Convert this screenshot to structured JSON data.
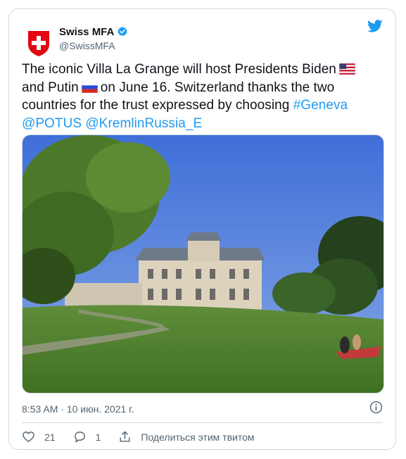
{
  "author": {
    "name": "Swiss MFA",
    "handle": "@SwissMFA",
    "avatar_icon": "swiss-cross-shield-icon",
    "verified_icon": "verified-badge-icon"
  },
  "colors": {
    "link": "#1d9bf0",
    "text": "#0f1419",
    "muted": "#536471",
    "border": "#cfd9de"
  },
  "tweet": {
    "part1": "The iconic Villa La Grange will host Presidents Biden",
    "flag_us_icon": "us-flag-icon",
    "part2": "and Putin",
    "flag_ru_icon": "russia-flag-icon",
    "part3": "on June 16. Switzerland thanks the two countries for the trust expressed by choosing",
    "hashtag": "#Geneva",
    "mention1": "@POTUS",
    "mention2": "@KremlinRussia_E"
  },
  "photo": {
    "subject": "villa-la-grange-photo"
  },
  "meta": {
    "time": "8:53 AM",
    "separator": "·",
    "date": "10 июн. 2021 г.",
    "info_icon": "info-icon"
  },
  "actions": {
    "likes": "21",
    "replies": "1",
    "share_label": "Поделиться этим твитом"
  }
}
